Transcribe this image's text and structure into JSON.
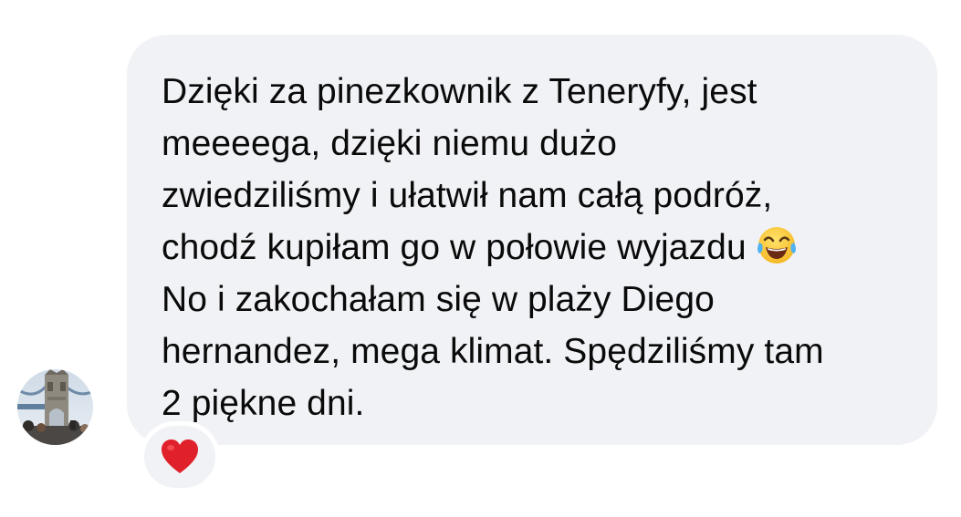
{
  "message": {
    "lines": [
      "Dzięki za pinezkownik z Teneryfy, jest",
      "meeeega, dzięki niemu dużo",
      "zwiedziliśmy i ułatwił nam całą podróż,",
      "chodź kupiłam go w połowie wyjazdu",
      "No i zakochałam się w plaży Diego",
      "hernandez, mega klimat. Spędziliśmy tam",
      "2 piękne dni."
    ],
    "inline_emoji": "face-with-tears-of-joy-icon"
  },
  "reaction": {
    "icon": "red-heart-icon",
    "color": "#e0202a"
  },
  "avatar": {
    "icon": "tower-bridge-photo"
  },
  "colors": {
    "bubble_bg": "#f1f2f6",
    "text": "#0a0a0a",
    "page_bg": "#ffffff"
  }
}
